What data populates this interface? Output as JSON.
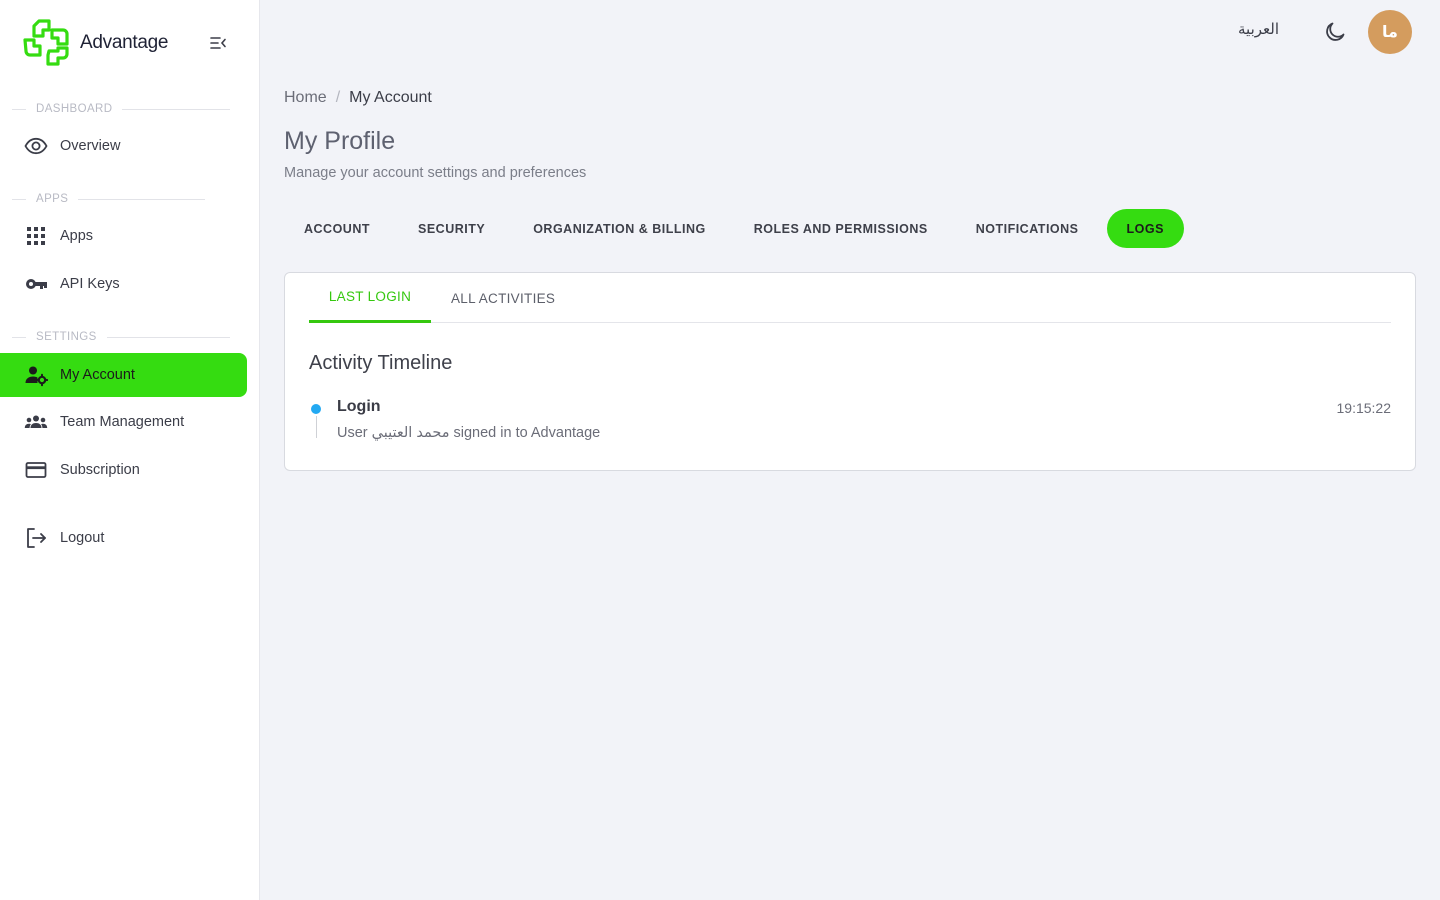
{
  "app": {
    "name": "Advantage",
    "brand_color": "#35dc11",
    "logo_icon": "advantage-logo-icon"
  },
  "sidebar": {
    "sections": [
      {
        "label": "DASHBOARD"
      },
      {
        "label": "APPS"
      },
      {
        "label": "SETTINGS"
      }
    ],
    "items": [
      {
        "label": "Overview",
        "icon": "eye-icon"
      },
      {
        "label": "Apps",
        "icon": "grid-icon"
      },
      {
        "label": "API Keys",
        "icon": "key-icon"
      },
      {
        "label": "My Account",
        "icon": "user-gear-icon",
        "active": true
      },
      {
        "label": "Team Management",
        "icon": "team-icon"
      },
      {
        "label": "Subscription",
        "icon": "credit-card-icon"
      },
      {
        "label": "Logout",
        "icon": "logout-icon"
      }
    ]
  },
  "topbar": {
    "language": "العربية",
    "theme_icon": "moon-icon",
    "avatar_initials": "ما",
    "avatar_color": "#d49c5e"
  },
  "breadcrumb": {
    "home": "Home",
    "separator": "/",
    "current": "My Account"
  },
  "page": {
    "title": "My Profile",
    "subtitle": "Manage your account settings and preferences"
  },
  "tabs": [
    {
      "label": "ACCOUNT"
    },
    {
      "label": "SECURITY"
    },
    {
      "label": "ORGANIZATION & BILLING"
    },
    {
      "label": "ROLES AND PERMISSIONS"
    },
    {
      "label": "NOTIFICATIONS"
    },
    {
      "label": "LOGS",
      "active": true
    }
  ],
  "logs": {
    "subtabs": [
      {
        "label": "LAST LOGIN",
        "active": true
      },
      {
        "label": "ALL ACTIVITIES"
      }
    ],
    "timeline_title": "Activity Timeline",
    "events": [
      {
        "title": "Login",
        "time": "19:15:22",
        "description": "User محمد العتيبي signed in to Advantage",
        "dot_color": "#23a9f2"
      }
    ]
  }
}
